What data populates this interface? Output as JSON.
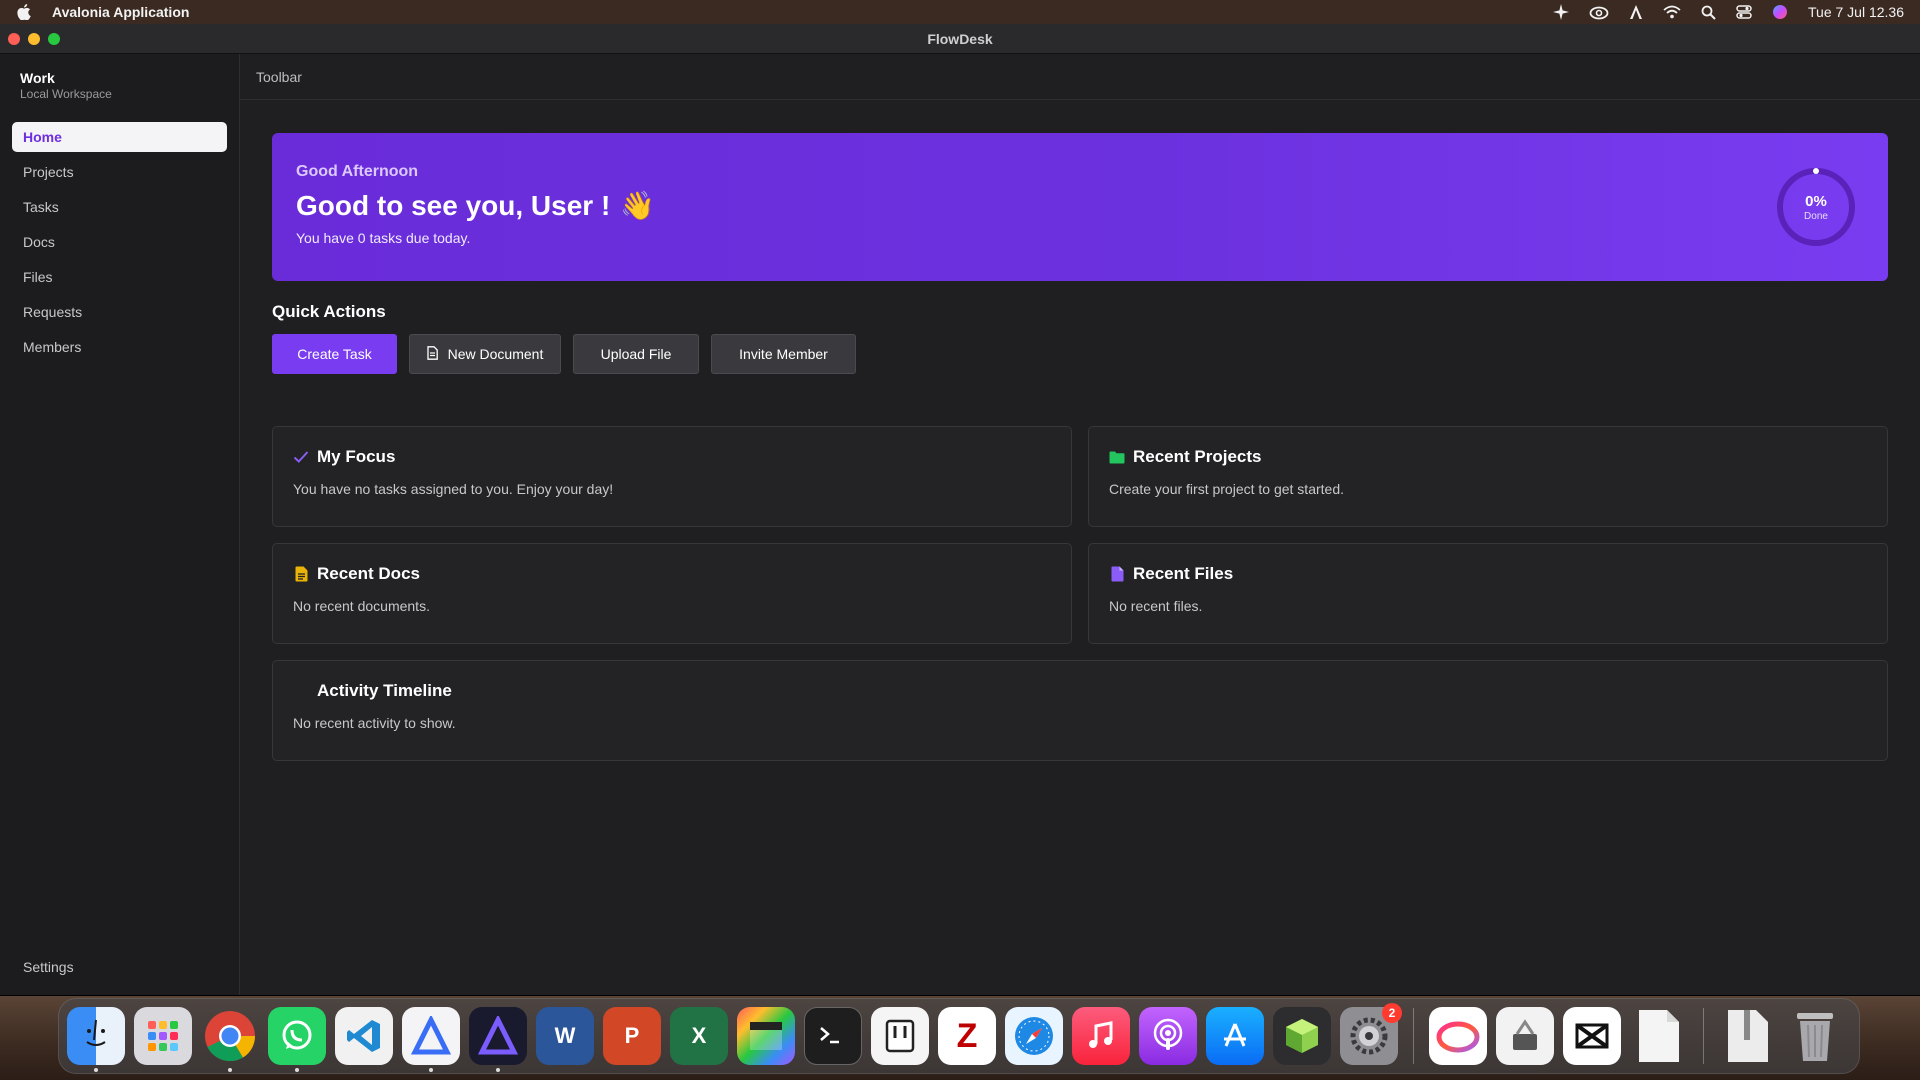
{
  "menubar": {
    "app_name": "Avalonia Application",
    "clock": "Tue 7 Jul  12.36",
    "icons": [
      "sparkle-icon",
      "creative-cloud-icon",
      "text-cursor-icon",
      "wifi-icon",
      "search-icon",
      "control-center-icon",
      "siri-icon"
    ]
  },
  "window": {
    "title": "FlowDesk"
  },
  "sidebar": {
    "workspace_name": "Work",
    "workspace_sub": "Local Workspace",
    "items": [
      {
        "label": "Home",
        "active": true
      },
      {
        "label": "Projects"
      },
      {
        "label": "Tasks"
      },
      {
        "label": "Docs"
      },
      {
        "label": "Files"
      },
      {
        "label": "Requests"
      },
      {
        "label": "Members"
      }
    ],
    "settings_label": "Settings"
  },
  "toolbar": {
    "label": "Toolbar"
  },
  "hero": {
    "greeting": "Good Afternoon",
    "headline": "Good to see you,  User !",
    "emoji": "👋",
    "subtext": "You have 0 tasks due today.",
    "progress_value": "0%",
    "progress_label": "Done",
    "progress_fraction": 0
  },
  "quick_actions": {
    "title": "Quick Actions",
    "create_task": "Create Task",
    "new_document": "New Document",
    "upload_file": "Upload File",
    "invite_member": "Invite Member"
  },
  "cards": {
    "focus": {
      "title": "My Focus",
      "text": "You have no tasks assigned to you. Enjoy your day!"
    },
    "projects": {
      "title": "Recent Projects",
      "text": "Create your first project to get started."
    },
    "docs": {
      "title": "Recent Docs",
      "text": "No recent documents."
    },
    "files": {
      "title": "Recent Files",
      "text": "No recent files."
    },
    "timeline": {
      "title": "Activity Timeline",
      "text": "No recent activity to show."
    }
  },
  "colors": {
    "accent": "#7a3cf0",
    "hero": "#6a2cd9",
    "check": "#8b5cf6",
    "folder": "#22c55e",
    "doc": "#eab308",
    "file": "#8b5cf6"
  },
  "dock": {
    "apps": [
      "finder-icon",
      "launchpad-icon",
      "chrome-icon",
      "whatsapp-icon",
      "vscode-icon",
      "affinity-designer-icon",
      "affinity-photo-icon",
      "word-icon",
      "powerpoint-icon",
      "excel-icon",
      "final-cut-icon",
      "terminal-icon",
      "notion-icon",
      "filezilla-icon",
      "safari-icon",
      "music-icon",
      "podcasts-icon",
      "app-store-icon",
      "3d-box-icon",
      "system-settings-icon",
      "creative-cloud-icon",
      "archive-utility-icon",
      "capcut-icon",
      "document-icon",
      "zip-icon",
      "trash-icon"
    ],
    "settings_badge": "2"
  }
}
